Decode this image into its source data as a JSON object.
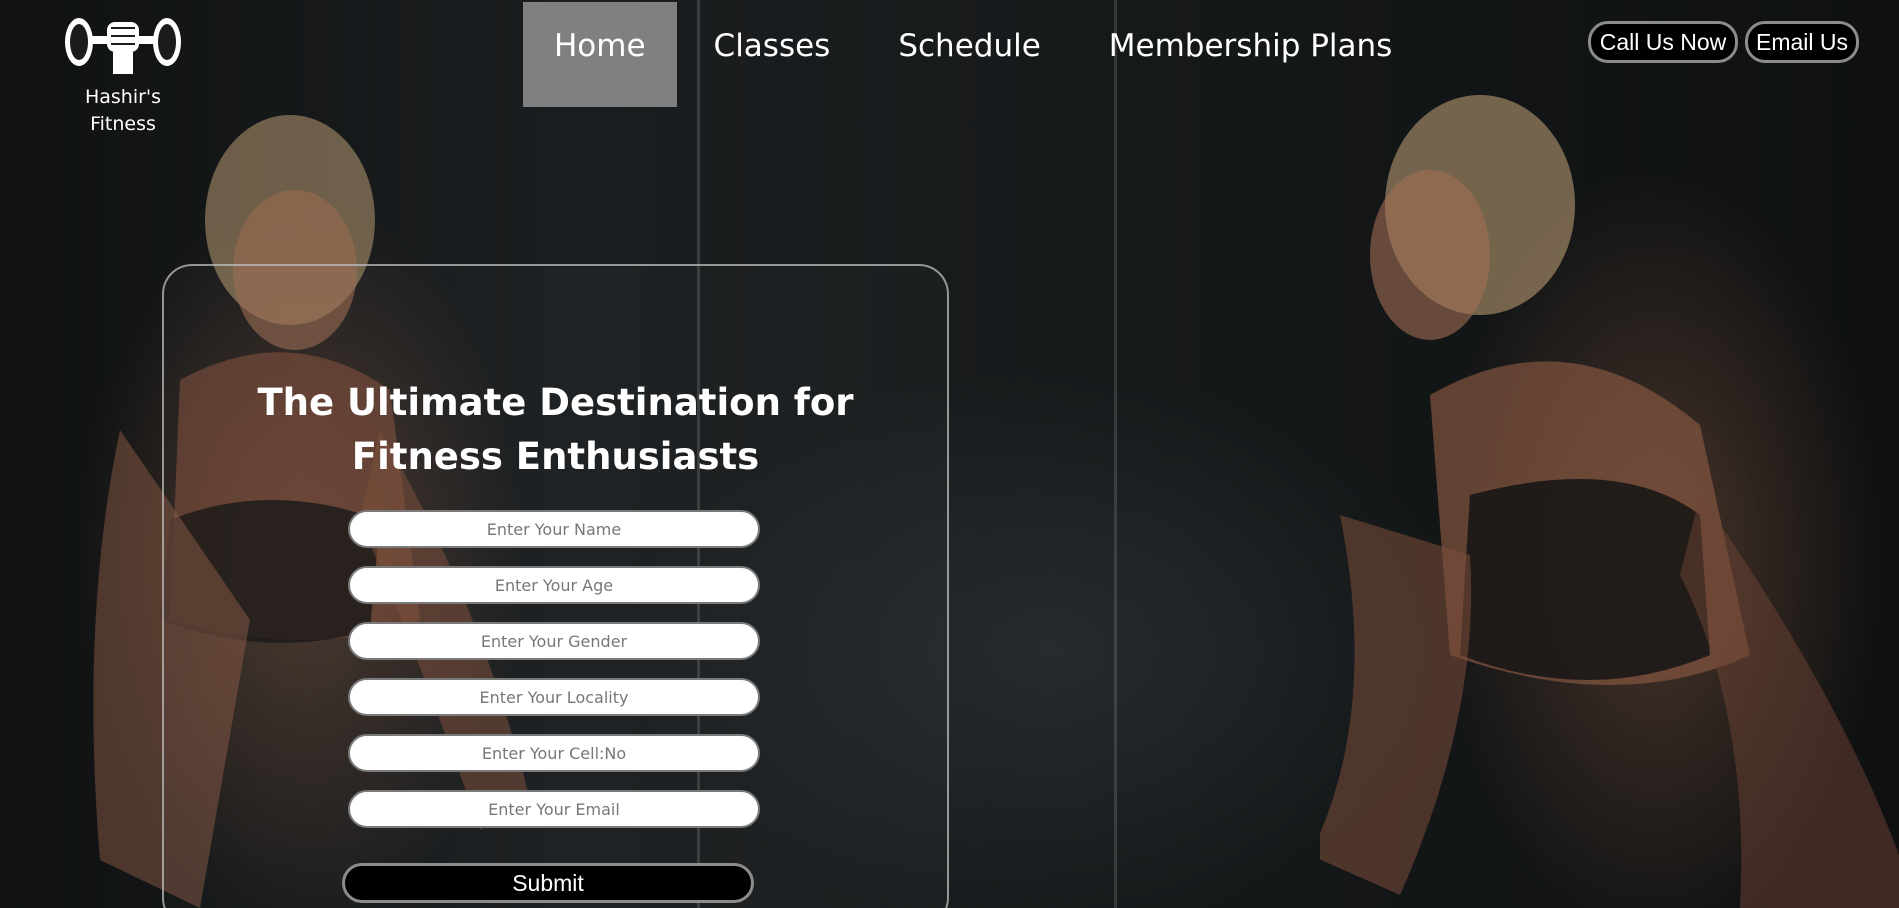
{
  "brand": {
    "name_line1": "Hashir's",
    "name_line2": "Fitness",
    "logo_icon": "dumbbell-fist-icon"
  },
  "nav": {
    "items": [
      {
        "label": "Home",
        "active": true
      },
      {
        "label": "Classes",
        "active": false
      },
      {
        "label": "Schedule",
        "active": false
      },
      {
        "label": "Membership Plans",
        "active": false
      }
    ]
  },
  "header_actions": {
    "call_label": "Call Us Now",
    "email_label": "Email Us"
  },
  "hero": {
    "headline_line1": "The Ultimate Destination for",
    "headline_line2": "Fitness Enthusiasts"
  },
  "form": {
    "name_placeholder": "Enter Your Name",
    "age_placeholder": "Enter Your Age",
    "gender_placeholder": "Enter Your Gender",
    "locality_placeholder": "Enter Your Locality",
    "cell_placeholder": "Enter Your Cell:No",
    "email_placeholder": "Enter Your Email",
    "submit_label": "Submit"
  },
  "colors": {
    "nav_active_bg": "#808080",
    "button_bg": "#000000",
    "button_border": "#8c8c8c",
    "text": "#ffffff"
  }
}
